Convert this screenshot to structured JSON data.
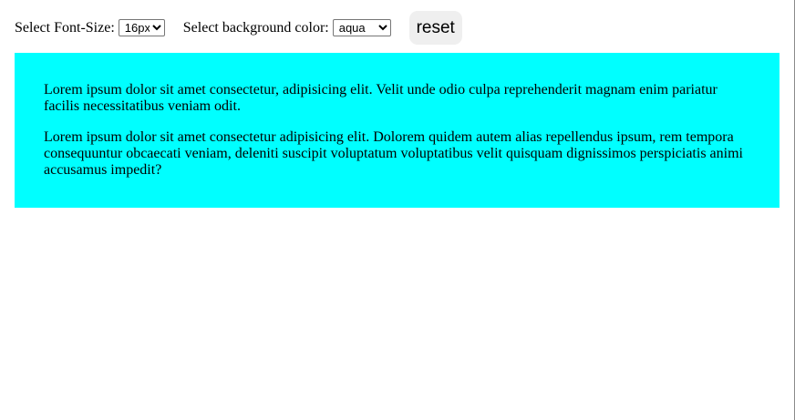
{
  "controls": {
    "font_size_label": "Select Font-Size:",
    "font_size_value": "16px",
    "background_label": "Select background color:",
    "background_value": "aqua",
    "reset_label": "reset"
  },
  "content": {
    "background_color": "#00ffff",
    "paragraphs": [
      "Lorem ipsum dolor sit amet consectetur, adipisicing elit. Velit unde odio culpa reprehenderit magnam enim pariatur facilis necessitatibus veniam odit.",
      "Lorem ipsum dolor sit amet consectetur adipisicing elit. Dolorem quidem autem alias repellendus ipsum, rem tempora consequuntur obcaecati veniam, deleniti suscipit voluptatum voluptatibus velit quisquam dignissimos perspiciatis animi accusamus impedit?"
    ]
  }
}
